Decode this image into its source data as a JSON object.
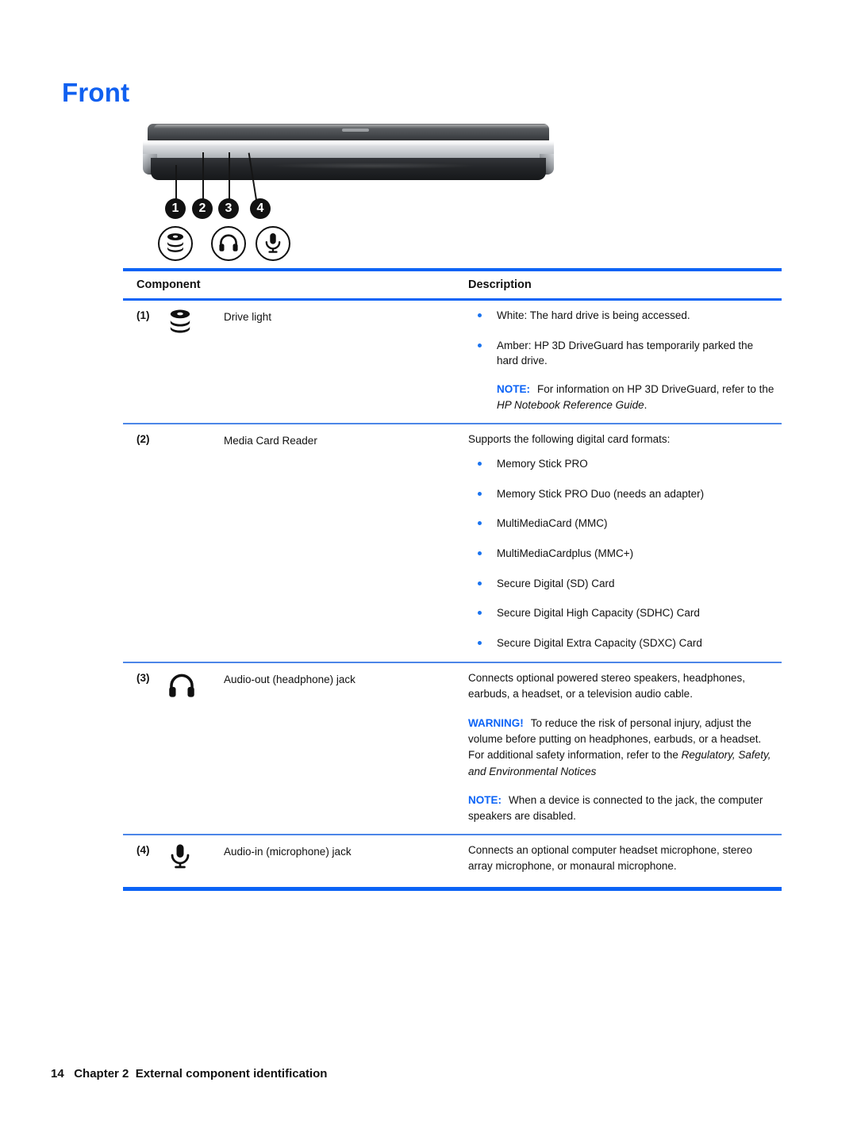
{
  "page": {
    "title": "Front",
    "title_color": "#1060f0",
    "rule_color": "#0b63f6"
  },
  "figure": {
    "alt": "HP notebook front edge view",
    "callouts": [
      "1",
      "2",
      "3",
      "4"
    ],
    "icons": [
      "drive-light-icon",
      "",
      "headphone-icon",
      "microphone-icon"
    ]
  },
  "table": {
    "headers": {
      "component": "Component",
      "description": "Description"
    },
    "rows": [
      {
        "num": "(1)",
        "icon": "drive-light-icon",
        "label": "Drive light",
        "bullets": [
          "White: The hard drive is being accessed.",
          "Amber: HP 3D DriveGuard has temporarily parked the hard drive."
        ],
        "note": {
          "keyword": "NOTE:",
          "text_before": "For information on HP 3D DriveGuard, refer to the ",
          "italic": "HP Notebook Reference Guide",
          "text_after": "."
        }
      },
      {
        "num": "(2)",
        "icon": "",
        "label": "Media Card Reader",
        "intro": "Supports the following digital card formats:",
        "bullets": [
          "Memory Stick PRO",
          "Memory Stick PRO Duo (needs an adapter)",
          "MultiMediaCard (MMC)",
          "MultiMediaCardplus (MMC+)",
          "Secure Digital (SD) Card",
          "Secure Digital High Capacity (SDHC) Card",
          "Secure Digital Extra Capacity (SDXC) Card"
        ]
      },
      {
        "num": "(3)",
        "icon": "headphone-icon",
        "label": "Audio-out (headphone) jack",
        "intro": "Connects optional powered stereo speakers, headphones, earbuds, a headset, or a television audio cable.",
        "warning": {
          "keyword": "WARNING!",
          "text_before": "To reduce the risk of personal injury, adjust the volume before putting on headphones, earbuds, or a headset. For additional safety information, refer to the ",
          "italic": "Regulatory, Safety, and Environmental Notices",
          "text_after": ""
        },
        "note": {
          "keyword": "NOTE:",
          "text_before": "When a device is connected to the jack, the computer speakers are disabled.",
          "italic": "",
          "text_after": ""
        }
      },
      {
        "num": "(4)",
        "icon": "microphone-icon",
        "label": "Audio-in (microphone) jack",
        "intro": "Connects an optional computer headset microphone, stereo array microphone, or monaural microphone."
      }
    ]
  },
  "footer": {
    "page_number": "14",
    "chapter": "Chapter 2",
    "chapter_title": "External component identification"
  }
}
